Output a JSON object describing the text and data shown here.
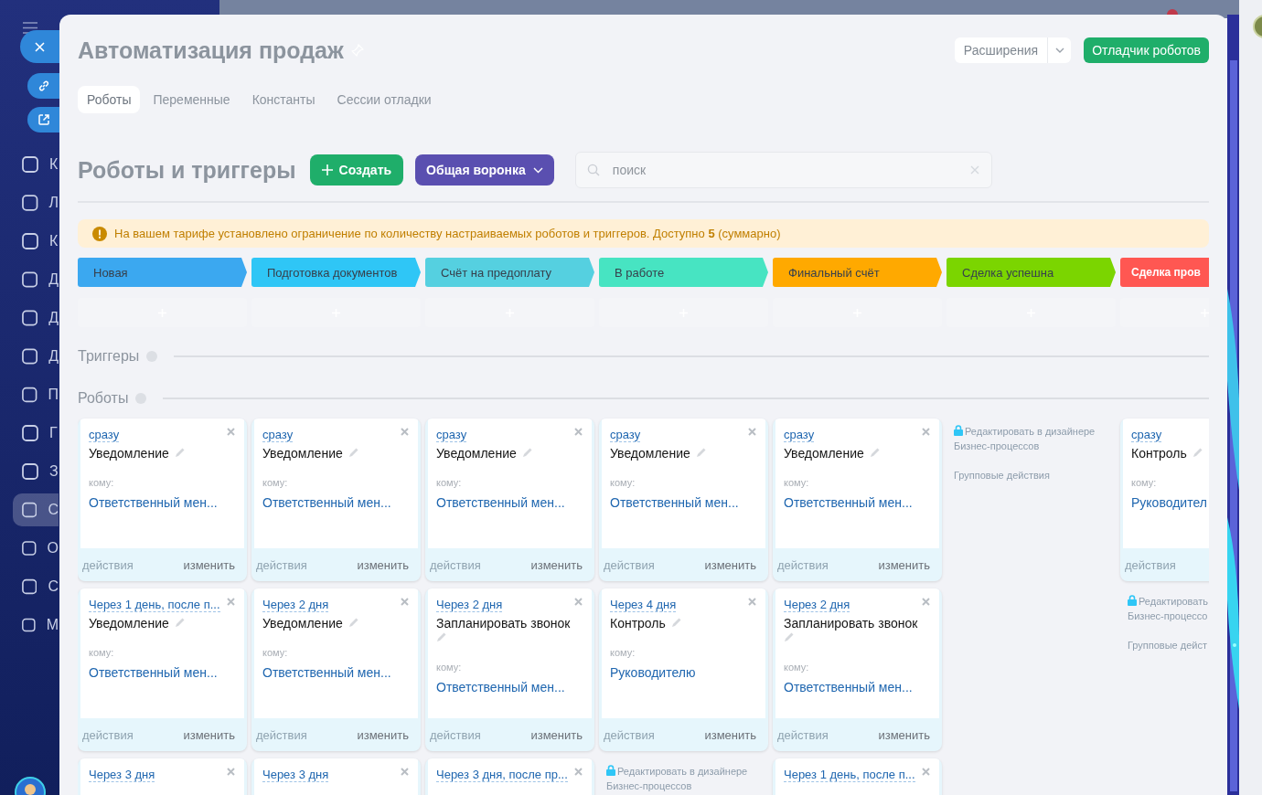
{
  "background_sidebar": {
    "items": [
      {
        "label": "К",
        "selected": false
      },
      {
        "label": "Л",
        "selected": false
      },
      {
        "label": "К",
        "selected": false
      },
      {
        "label": "Д",
        "selected": false
      },
      {
        "label": "Д",
        "selected": false
      },
      {
        "label": "Д",
        "selected": false
      },
      {
        "label": "П",
        "selected": false
      },
      {
        "label": "Г",
        "selected": false
      },
      {
        "label": "З",
        "selected": false
      },
      {
        "label": "С",
        "selected": true
      },
      {
        "label": "О",
        "selected": false
      },
      {
        "label": "С",
        "selected": false
      },
      {
        "label": "М",
        "selected": false
      }
    ]
  },
  "panel": {
    "title": "Автоматизация продаж",
    "tabs": [
      {
        "label": "Роботы",
        "selected": true
      },
      {
        "label": "Переменные",
        "selected": false
      },
      {
        "label": "Константы",
        "selected": false
      },
      {
        "label": "Сессии отладки",
        "selected": false
      }
    ],
    "extensions_button": "Расширения",
    "debugger_button": "Отладчик роботов"
  },
  "toolbar": {
    "heading": "Роботы и триггеры",
    "create_button": "Создать",
    "funnel_button": "Общая воронка",
    "search": {
      "placeholder": "поиск"
    }
  },
  "notice": "На вашем тарифе установлено ограничение по количеству настраиваемых роботов и триггеров. Доступно **5** (суммарно)",
  "stages": [
    {
      "name": "Новая",
      "color": "#3ba8f0"
    },
    {
      "name": "Подготовка документов",
      "color": "#2fc6f6"
    },
    {
      "name": "Счёт на предоплату",
      "color": "#55d0e0"
    },
    {
      "name": "В работе",
      "color": "#47e4c2"
    },
    {
      "name": "Финальный счёт",
      "color": "#ffa900"
    },
    {
      "name": "Сделка успешна",
      "color": "#7bd500"
    },
    {
      "name": "Сделка пров",
      "color": "#ff5752"
    }
  ],
  "triggers_heading": "Триггеры",
  "robots_heading": "Роботы",
  "robot_columns": [
    {
      "items": [
        {
          "kind": "robot",
          "when": "сразу",
          "name": "Уведомление",
          "to_label": "кому:",
          "to": "Ответственный мен...",
          "actions": "действия",
          "edit": "изменить"
        },
        {
          "kind": "robot",
          "when": "Через 1 день, после п...",
          "name": "Уведомление",
          "to_label": "кому:",
          "to": "Ответственный мен...",
          "actions": "действия",
          "edit": "изменить"
        },
        {
          "kind": "robot",
          "when": "Через 3 дня"
        }
      ]
    },
    {
      "items": [
        {
          "kind": "robot",
          "when": "сразу",
          "name": "Уведомление",
          "to_label": "кому:",
          "to": "Ответственный мен...",
          "actions": "действия",
          "edit": "изменить"
        },
        {
          "kind": "robot",
          "when": "Через 2 дня",
          "name": "Уведомление",
          "to_label": "кому:",
          "to": "Ответственный мен...",
          "actions": "действия",
          "edit": "изменить"
        },
        {
          "kind": "robot",
          "when": "Через 3 дня"
        }
      ]
    },
    {
      "items": [
        {
          "kind": "robot",
          "when": "сразу",
          "name": "Уведомление",
          "to_label": "кому:",
          "to": "Ответственный мен...",
          "actions": "действия",
          "edit": "изменить"
        },
        {
          "kind": "robot",
          "when": "Через 2 дня",
          "name": "Запланировать звонок",
          "to_label": "кому:",
          "to": "Ответственный мен...",
          "actions": "действия",
          "edit": "изменить"
        },
        {
          "kind": "robot",
          "when": "Через 3 дня, после пр..."
        }
      ]
    },
    {
      "items": [
        {
          "kind": "robot",
          "when": "сразу",
          "name": "Уведомление",
          "to_label": "кому:",
          "to": "Ответственный мен...",
          "actions": "действия",
          "edit": "изменить"
        },
        {
          "kind": "robot",
          "when": "Через 4 дня",
          "name": "Контроль",
          "to_label": "кому:",
          "to": "Руководителю",
          "actions": "действия",
          "edit": "изменить"
        },
        {
          "kind": "designer",
          "link_lines": [
            "Редактировать в дизайнере",
            "Бизнес-процессов"
          ]
        }
      ]
    },
    {
      "items": [
        {
          "kind": "robot",
          "when": "сразу",
          "name": "Уведомление",
          "to_label": "кому:",
          "to": "Ответственный мен...",
          "actions": "действия",
          "edit": "изменить"
        },
        {
          "kind": "robot",
          "when": "Через 2 дня",
          "name": "Запланировать звонок",
          "to_label": "кому:",
          "to": "Ответственный мен...",
          "actions": "действия",
          "edit": "изменить"
        },
        {
          "kind": "robot",
          "when": "Через 1 день, после п..."
        }
      ]
    },
    {
      "items": [
        {
          "kind": "designer",
          "link_lines": [
            "Редактировать в дизайнере",
            "Бизнес-процессов"
          ],
          "group": "Групповые действия"
        }
      ]
    },
    {
      "items": [
        {
          "kind": "robot",
          "when": "сразу",
          "name": "Контроль",
          "to_label": "кому:",
          "to": "Руководител",
          "actions": "действия"
        },
        {
          "kind": "designer",
          "link_lines": [
            "Редактировать",
            "Бизнес-процессо"
          ],
          "group": "Групповые дейст"
        }
      ]
    }
  ]
}
